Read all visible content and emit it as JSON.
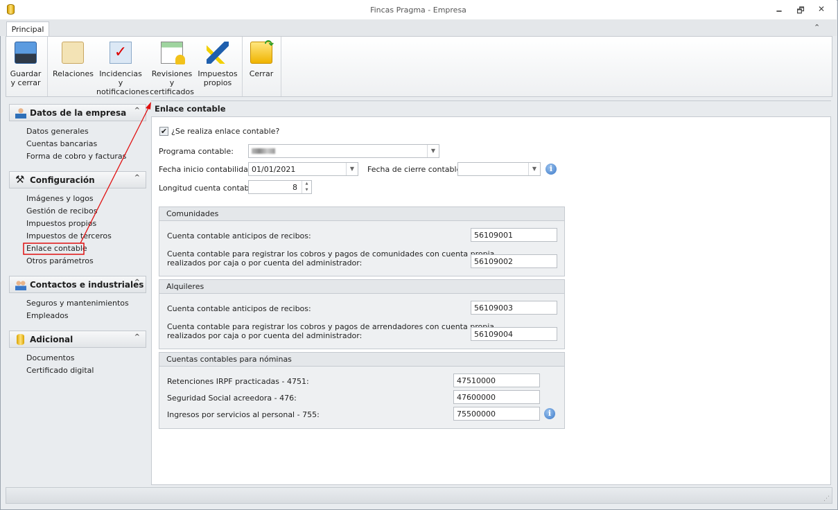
{
  "window": {
    "title": "Fincas Pragma - Empresa",
    "minimize": "🗕",
    "restore": "🗗",
    "close": "✕"
  },
  "tabs": [
    {
      "label": "Principal"
    }
  ],
  "ribbon": {
    "collapse": "⌃",
    "buttons": [
      {
        "label1": "Guardar",
        "label2": "y cerrar",
        "icon": "floppy-icon"
      },
      {
        "label1": "Relaciones",
        "label2": "",
        "icon": "contacts-icon"
      },
      {
        "label1": "Incidencias y",
        "label2": "notificaciones",
        "icon": "mail-check-icon"
      },
      {
        "label1": "Revisiones y",
        "label2": "certificados",
        "icon": "bell-document-icon"
      },
      {
        "label1": "Impuestos",
        "label2": "propios",
        "icon": "tax-agency-icon"
      },
      {
        "label1": "Cerrar",
        "label2": "",
        "icon": "folder-exit-icon"
      }
    ]
  },
  "sidebar": {
    "groups": [
      {
        "title": "Datos de la empresa",
        "items": [
          "Datos generales",
          "Cuentas bancarias",
          "Forma de cobro y facturas"
        ]
      },
      {
        "title": "Configuración",
        "items": [
          "Imágenes y logos",
          "Gestión de recibos",
          "Impuestos propios",
          "Impuestos de terceros",
          "Enlace contable",
          "Otros parámetros"
        ]
      },
      {
        "title": "Contactos e industriales",
        "items": [
          "Seguros y mantenimientos",
          "Empleados"
        ]
      },
      {
        "title": "Adicional",
        "items": [
          "Documentos",
          "Certificado digital"
        ]
      }
    ],
    "chevron": "^",
    "selected": "Enlace contable"
  },
  "panel": {
    "title": "Enlace contable",
    "checkbox_label": "¿Se realiza enlace contable?",
    "checkbox_checked": true,
    "programa_label": "Programa contable:",
    "programa_value": "(blurred)",
    "fecha_inicio_label": "Fecha inicio contabilidad:",
    "fecha_inicio_value": "01/01/2021",
    "fecha_cierre_label": "Fecha de cierre contable:",
    "fecha_cierre_value": "",
    "longitud_label": "Longitud cuenta contable:",
    "longitud_value": "8",
    "info": "i",
    "dd": "▼",
    "up": "▲",
    "down": "▼"
  },
  "groups": {
    "comunidades": {
      "title": "Comunidades",
      "r1": "Cuenta contable anticipos de recibos:",
      "v1": "56109001",
      "r2a": "Cuenta contable para registrar los cobros y pagos de comunidades con cuenta propia",
      "r2b": "realizados por caja o por cuenta del administrador:",
      "v2": "56109002"
    },
    "alquileres": {
      "title": "Alquileres",
      "r1": "Cuenta contable anticipos de recibos:",
      "v1": "56109003",
      "r2a": "Cuenta contable para registrar los cobros y pagos de arrendadores con cuenta propia",
      "r2b": "realizados por caja o por cuenta del administrador:",
      "v2": "56109004"
    },
    "nominas": {
      "title": "Cuentas contables para nóminas",
      "r1": "Retenciones IRPF practicadas - 4751:",
      "v1": "47510000",
      "r2": "Seguridad Social acreedora - 476:",
      "v2": "47600000",
      "r3": "Ingresos por servicios al personal - 755:",
      "v3": "75500000"
    }
  },
  "colors": {
    "annotation": "#e01010",
    "accent": "#3a78c8"
  }
}
